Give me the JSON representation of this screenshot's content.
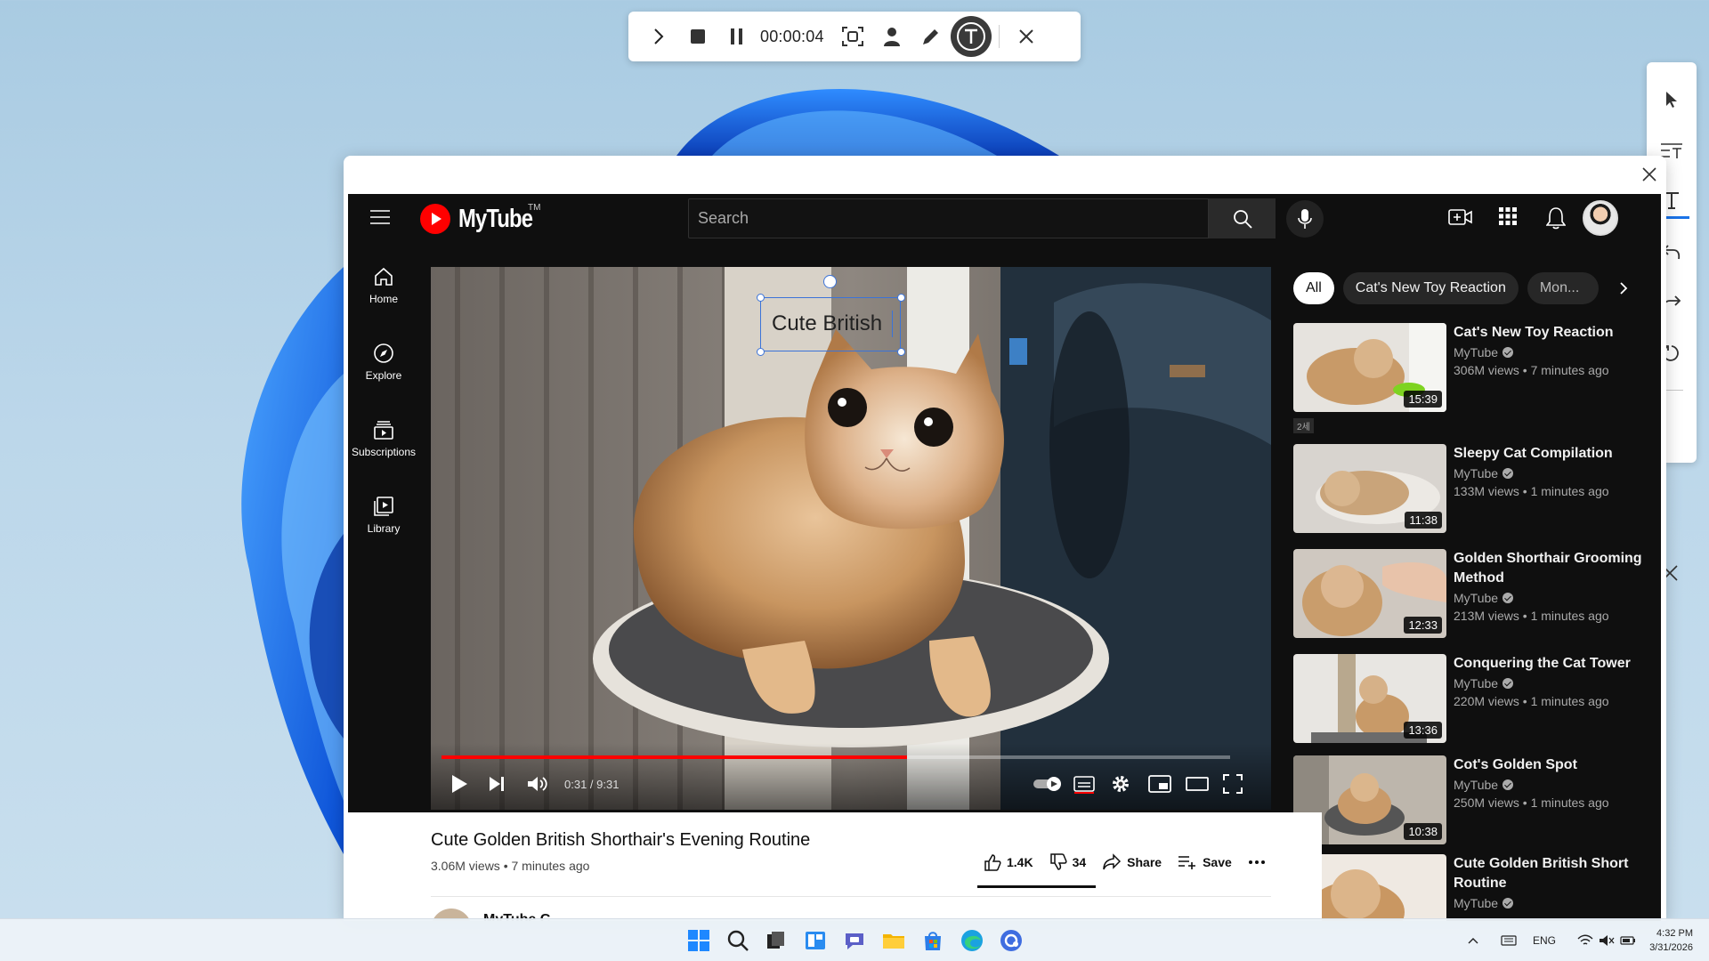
{
  "recorder": {
    "timer": "00:00:04"
  },
  "header": {
    "logo_text": "MyTube",
    "logo_tm": "TM",
    "search_placeholder": "Search"
  },
  "sidebar": {
    "items": [
      {
        "label": "Home",
        "icon": "home-icon"
      },
      {
        "label": "Explore",
        "icon": "compass-icon"
      },
      {
        "label": "Subscriptions",
        "icon": "subscriptions-icon"
      },
      {
        "label": "Library",
        "icon": "library-icon"
      }
    ]
  },
  "player": {
    "annotation_text": "Cute British",
    "time": "0:31 / 9:31",
    "progress": 0.59
  },
  "chips": [
    "All",
    "Cat's New Toy Reaction",
    "Mon..."
  ],
  "tag": "2세",
  "suggestions": [
    {
      "title": "Cat's New Toy Reaction",
      "channel": "MyTube",
      "stats": "306M views • 7 minutes ago",
      "duration": "15:39"
    },
    {
      "title": "Sleepy Cat Compilation",
      "channel": "MyTube",
      "stats": "133M views • 1 minutes ago",
      "duration": "11:38"
    },
    {
      "title": "Golden Shorthair Grooming Method",
      "channel": "MyTube",
      "stats": "213M views • 1 minutes ago",
      "duration": "12:33"
    },
    {
      "title": "Conquering the Cat Tower",
      "channel": "MyTube",
      "stats": "220M views • 1 minutes ago",
      "duration": "13:36"
    },
    {
      "title": "Cot's Golden Spot",
      "channel": "MyTube",
      "stats": "250M views • 1 minutes ago",
      "duration": "10:38"
    },
    {
      "title": "Cute Golden British Short Routine",
      "channel": "MyTube",
      "stats": "",
      "duration": ""
    }
  ],
  "video": {
    "title": "Cute Golden British Shorthair's Evening Routine",
    "meta": "3.06M views • 7 minutes ago",
    "likes": "1.4K",
    "dislikes": "34",
    "share": "Share",
    "save": "Save",
    "channel": "MyTube C..."
  },
  "tray": {
    "lang": "ENG",
    "time": "4:32 PM",
    "date": "3/31/2026"
  },
  "colors": {
    "brand_red": "#ff0000",
    "selection_blue": "#3b73d8",
    "dark_bg": "#0f0f0f"
  }
}
